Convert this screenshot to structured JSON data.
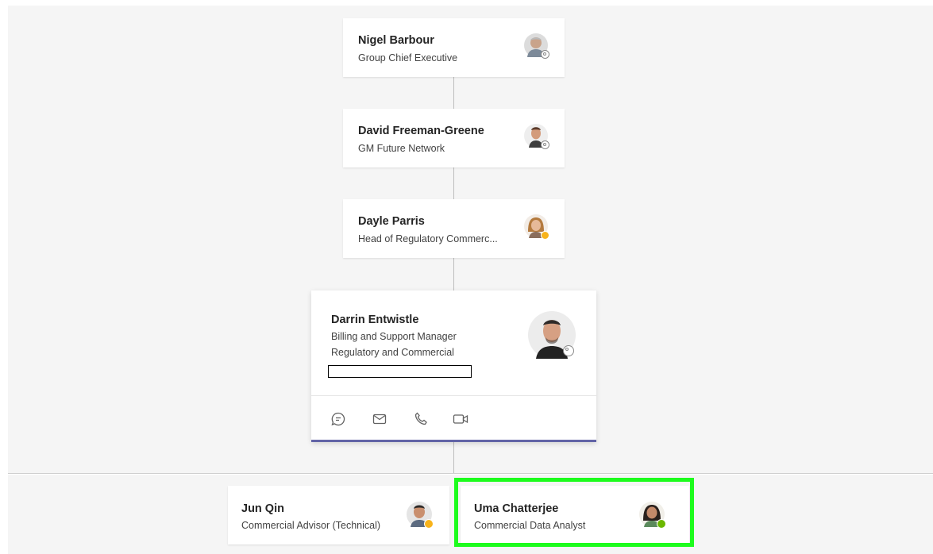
{
  "org_chart": {
    "chain": [
      {
        "name": "Nigel Barbour",
        "title": "Group Chief Executive",
        "presence": "offline"
      },
      {
        "name": "David Freeman-Greene",
        "title": "GM Future Network",
        "presence": "offline"
      },
      {
        "name": "Dayle Parris",
        "title": "Head of Regulatory Commerc...",
        "presence": "away"
      }
    ],
    "focus": {
      "name": "Darrin Entwistle",
      "title_line1": "Billing and Support Manager",
      "title_line2": "Regulatory and Commercial",
      "presence": "offline",
      "actions": [
        {
          "icon": "chat-icon"
        },
        {
          "icon": "mail-icon"
        },
        {
          "icon": "phone-icon"
        },
        {
          "icon": "video-icon"
        }
      ]
    },
    "reports": [
      {
        "name": "Jun Qin",
        "title": "Commercial Advisor (Technical)",
        "presence": "away"
      },
      {
        "name": "Uma Chatterjee",
        "title": "Commercial Data Analyst",
        "presence": "available",
        "highlighted": true
      }
    ]
  },
  "colors": {
    "accent": "#6264a7",
    "highlight": "#1dfc1d",
    "away": "#f8b31b",
    "available": "#6bb700"
  }
}
